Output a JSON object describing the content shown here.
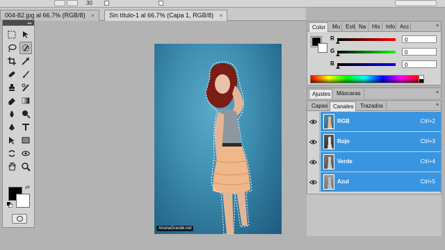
{
  "options_bar": {
    "value": "30"
  },
  "tabs": [
    {
      "label": "004-82.jpg al 66.7% (RGB/8)",
      "close": "×",
      "active": false
    },
    {
      "label": "Sin título-1 al 66.7% (Capa 1, RGB/8)",
      "close": "×",
      "active": true
    }
  ],
  "tools": {
    "icons": [
      "marquee-icon",
      "move-icon",
      "lasso-icon",
      "quick-selection-icon",
      "crop-icon",
      "eyedropper-icon",
      "healing-brush-icon",
      "brush-icon",
      "clone-stamp-icon",
      "history-brush-icon",
      "eraser-icon",
      "gradient-icon",
      "blur-icon",
      "dodge-icon",
      "pen-icon",
      "type-icon",
      "path-selection-icon",
      "shape-icon",
      "3d-rotate-icon",
      "3d-orbit-icon",
      "hand-icon",
      "zoom-icon"
    ],
    "foreground_color": "#000000",
    "background_color": "#ffffff",
    "swap_glyph": "⇄"
  },
  "canvas": {
    "watermark": "ArianaGrande.net",
    "background_color": "#3f8fb2"
  },
  "color_panel": {
    "tabs": [
      "Color",
      "Mu",
      "Esti",
      "Na",
      "His",
      "Info",
      "Acc"
    ],
    "menu_glyph": "≡",
    "rows": [
      {
        "label": "R",
        "value": "0",
        "bar": "linear-gradient(to right,#000,#f00)"
      },
      {
        "label": "G",
        "value": "0",
        "bar": "linear-gradient(to right,#000,#0f0)"
      },
      {
        "label": "B",
        "value": "0",
        "bar": "linear-gradient(to right,#000,#00f)"
      }
    ]
  },
  "adjust_panel": {
    "tabs": [
      "Ajustes",
      "Máscaras"
    ],
    "menu_glyph": "≡"
  },
  "channels_panel": {
    "tabs": [
      "Capas",
      "Canales",
      "Trazados"
    ],
    "menu_glyph": "≡",
    "channels": [
      {
        "name": "RGB",
        "shortcut": "Ctrl+2"
      },
      {
        "name": "Rojo",
        "shortcut": "Ctrl+3"
      },
      {
        "name": "Verde",
        "shortcut": "Ctrl+4"
      },
      {
        "name": "Azul",
        "shortcut": "Ctrl+5"
      }
    ]
  },
  "colors": {
    "selection": "#3a95e0",
    "panel_bg": "#d3d3d3",
    "workspace": "#b3b3b3"
  }
}
